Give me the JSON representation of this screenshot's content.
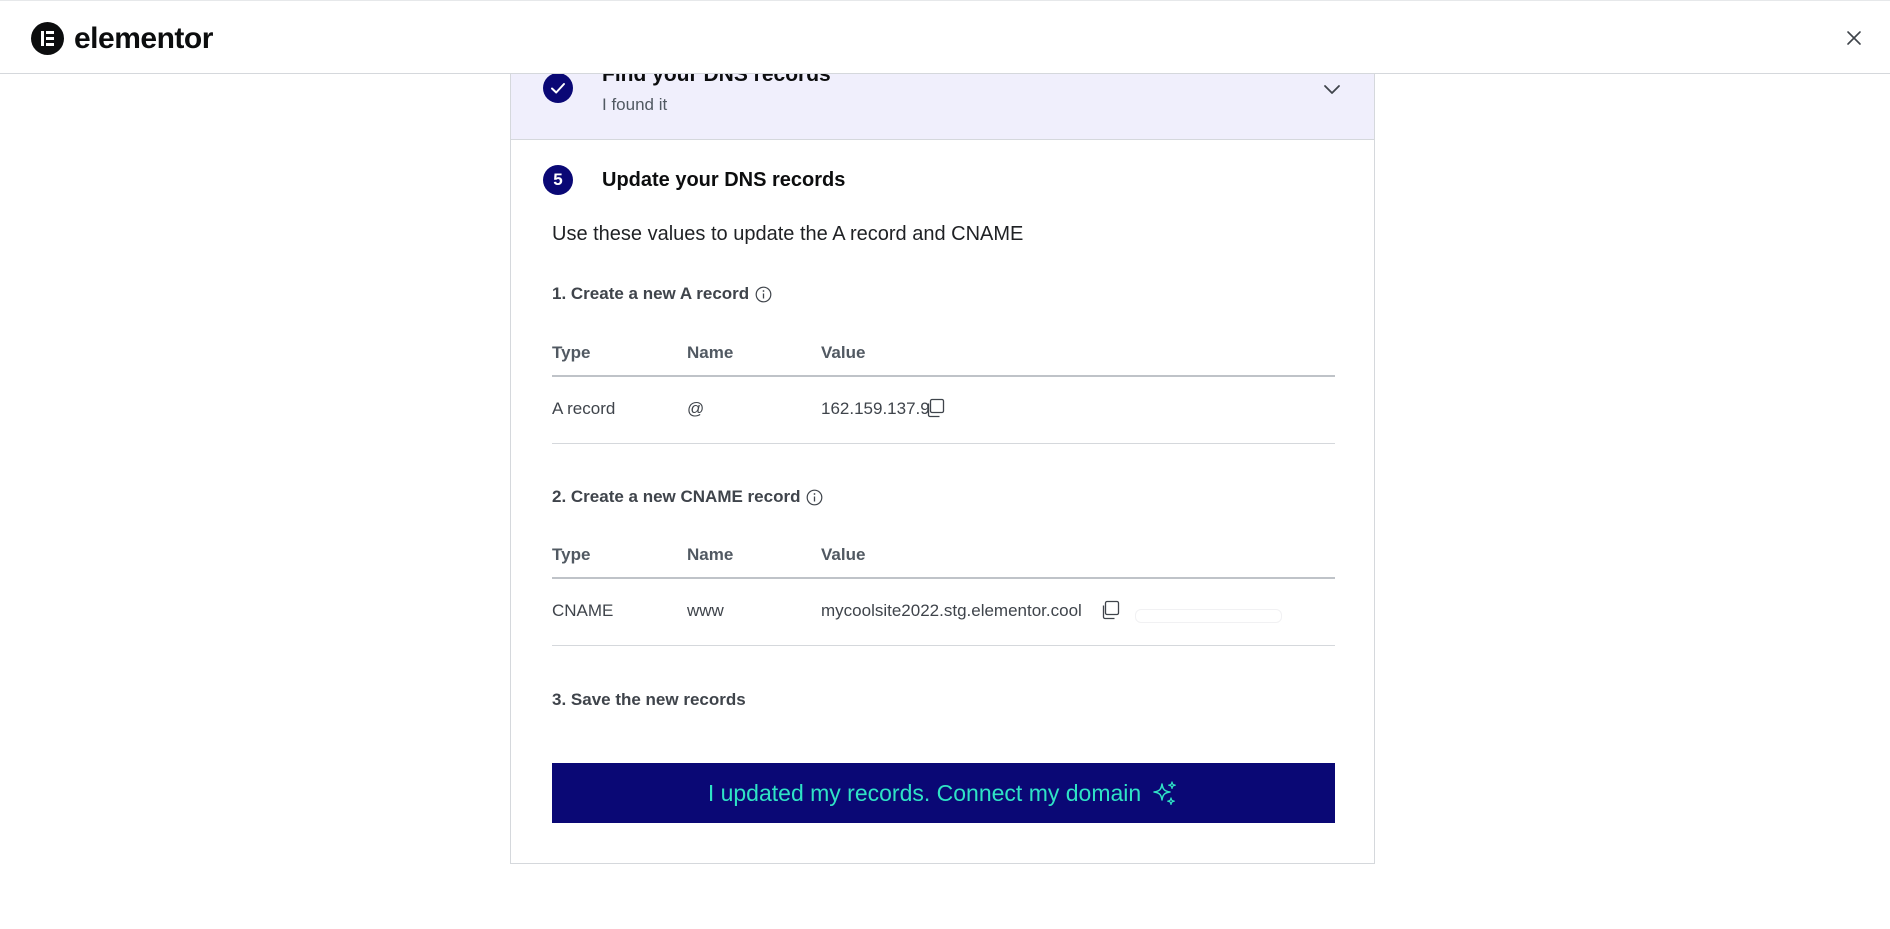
{
  "header": {
    "brand": "elementor",
    "close_label": "×"
  },
  "step4": {
    "title": "Find your DNS records",
    "subtitle": "I found it"
  },
  "step5": {
    "number": "5",
    "title": "Update your DNS records",
    "intro": "Use these values to update the A record and CNAME"
  },
  "a_record": {
    "section_title": "1. Create a new A record",
    "headers": {
      "type": "Type",
      "name": "Name",
      "value": "Value"
    },
    "row": {
      "type": "A record",
      "name": "@",
      "value": "162.159.137.9"
    }
  },
  "cname_record": {
    "section_title": "2. Create a new CNAME record",
    "headers": {
      "type": "Type",
      "name": "Name",
      "value": "Value"
    },
    "row": {
      "type": "CNAME",
      "name": "www",
      "value": "mycoolsite2022.stg.elementor.cool"
    }
  },
  "save": {
    "section_title": "3. Save the new records"
  },
  "cta": {
    "label": "I updated my records. Connect my domain"
  },
  "colors": {
    "primary": "#0a0875",
    "accent": "#2fe3c5",
    "step_bg": "#f0effc"
  },
  "icons": {
    "logo": "elementor-logo-icon",
    "close": "close-icon",
    "check": "check-icon",
    "chevron": "chevron-down-icon",
    "info": "info-icon",
    "copy": "copy-icon",
    "sparkle": "sparkle-icon"
  }
}
